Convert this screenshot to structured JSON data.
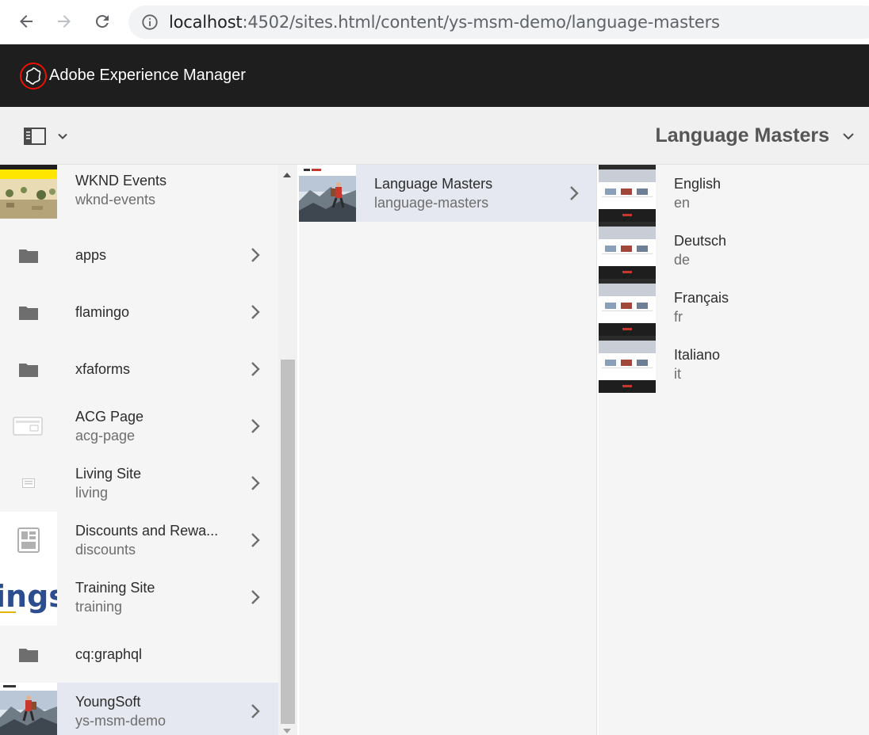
{
  "browser": {
    "url_host": "localhost",
    "url_rest": ":4502/sites.html/content/ys-msm-demo/language-masters"
  },
  "header": {
    "product_name": "Adobe Experience Manager"
  },
  "actionbar": {
    "view_title": "Language Masters"
  },
  "column1": {
    "items": [
      {
        "title": "WKND Events",
        "name": "wknd-events"
      },
      {
        "title": "apps",
        "name": ""
      },
      {
        "title": "flamingo",
        "name": ""
      },
      {
        "title": "xfaforms",
        "name": ""
      },
      {
        "title": "ACG Page",
        "name": "acg-page"
      },
      {
        "title": "Living Site",
        "name": "living"
      },
      {
        "title": "Discounts and Rewa...",
        "name": "discounts"
      },
      {
        "title": "Training Site",
        "name": "training"
      },
      {
        "title": "cq:graphql",
        "name": ""
      },
      {
        "title": "YoungSoft",
        "name": "ys-msm-demo"
      }
    ]
  },
  "column2": {
    "items": [
      {
        "title": "Language Masters",
        "name": "language-masters"
      }
    ]
  },
  "column3": {
    "items": [
      {
        "title": "English",
        "name": "en"
      },
      {
        "title": "Deutsch",
        "name": "de"
      },
      {
        "title": "Français",
        "name": "fr"
      },
      {
        "title": "Italiano",
        "name": "it"
      }
    ]
  },
  "thumbnail_text": {
    "training_fragment": "ings"
  },
  "icons": {
    "back": "arrow-left-icon",
    "forward": "arrow-right-icon",
    "reload": "reload-icon",
    "info": "info-icon",
    "aem_logo": "adobe-experience-manager-logo",
    "rail": "rail-toggle-icon",
    "folder": "folder-icon",
    "chevron": "chevron-right-icon"
  },
  "colors": {
    "header_bg": "#1e1e1e",
    "selected_row": "#e5e8f0",
    "logo_accent": "#eb1000"
  }
}
